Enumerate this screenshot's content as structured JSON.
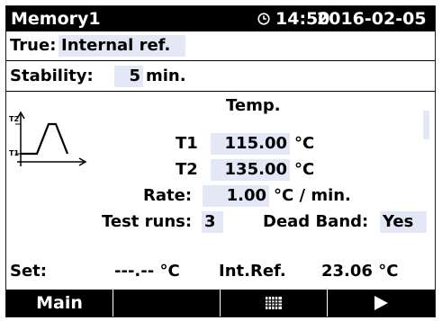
{
  "header": {
    "title": "Memory1",
    "clock_icon": "clock-icon",
    "time": "14:50",
    "date": "2016-02-05"
  },
  "true_row": {
    "label": "True:",
    "value": "Internal ref."
  },
  "stability_row": {
    "label": "Stability:",
    "value": "5",
    "unit": "min."
  },
  "temp_header": "Temp.",
  "diagram": {
    "icon": "temperature-profile-icon",
    "upper_label": "T2",
    "lower_label": "T1"
  },
  "t1": {
    "label": "T1",
    "value": "115.00",
    "unit": "°C"
  },
  "t2": {
    "label": "T2",
    "value": "135.00",
    "unit": "°C"
  },
  "rate": {
    "label": "Rate:",
    "value": "1.00",
    "unit": "°C / min."
  },
  "test_runs": {
    "label": "Test runs:",
    "value": "3"
  },
  "dead_band": {
    "label": "Dead Band:",
    "value": "Yes"
  },
  "status": {
    "set_label": "Set:",
    "set_value": "---.-- °C",
    "intref_label": "Int.Ref.",
    "intref_value": "23.06 °C"
  },
  "softkeys": {
    "main_label": "Main",
    "keypad_icon": "keypad-grid-icon",
    "next_icon": "play-arrow-icon"
  },
  "colors": {
    "field_bg": "#e4e7f5",
    "bar_bg": "#000000",
    "text": "#000000"
  }
}
